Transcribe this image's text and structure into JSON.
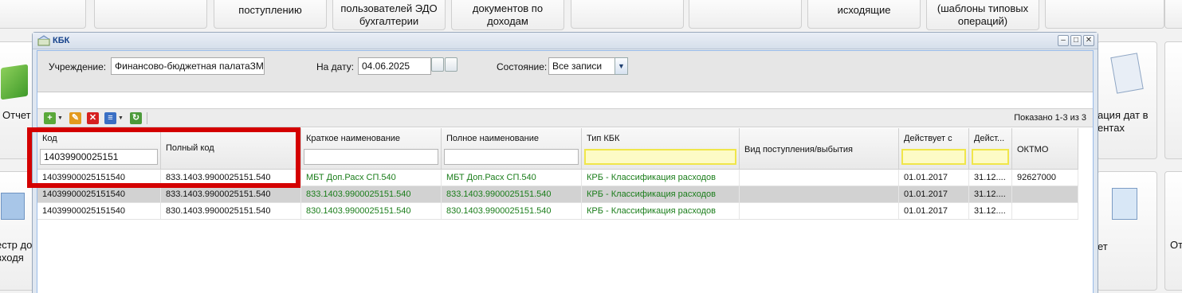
{
  "background_tiles": [
    {
      "id": "tile-1",
      "label": ""
    },
    {
      "id": "tile-2",
      "label": "поступлению"
    },
    {
      "id": "tile-3",
      "label": "пользователей ЭДО бухгалтерии"
    },
    {
      "id": "tile-4",
      "label": "документов по доходам"
    },
    {
      "id": "tile-5",
      "label": ""
    },
    {
      "id": "tile-6",
      "label": ""
    },
    {
      "id": "tile-7",
      "label": "исходящие"
    },
    {
      "id": "tile-8",
      "label": "(шаблоны типовых операций)"
    },
    {
      "id": "tile-left-1",
      "label": "Отчет"
    },
    {
      "id": "tile-left-2",
      "label": "естр до входя"
    },
    {
      "id": "tile-right-1",
      "label": "ация дат в ентах"
    },
    {
      "id": "tile-right-2",
      "label": "ет"
    },
    {
      "id": "tile-right-3",
      "label": "От"
    }
  ],
  "window": {
    "title": "КБК",
    "buttons": {
      "minimize": "–",
      "maximize": "□",
      "close": "✕"
    }
  },
  "filters": {
    "institution_label": "Учреждение:",
    "institution_value": "Финансово-бюджетная палатаЗМ",
    "date_label": "На дату:",
    "date_value": "04.06.2025",
    "state_label": "Состояние:",
    "state_value": "Все записи"
  },
  "toolbar": {
    "add_icon": "+",
    "edit_icon": "✎",
    "delete_icon": "✕",
    "list_icon": "≡",
    "refresh_icon": "↻",
    "shown_text": "Показано 1-3 из 3"
  },
  "grid": {
    "columns": [
      {
        "key": "code",
        "label": "Код",
        "filter": "14039900025151"
      },
      {
        "key": "full_code",
        "label": "Полный код",
        "filter": ""
      },
      {
        "key": "short_name",
        "label": "Краткое наименование",
        "filter": ""
      },
      {
        "key": "full_name",
        "label": "Полное наименование",
        "filter": ""
      },
      {
        "key": "kbk_type",
        "label": "Тип КБК",
        "filter": ""
      },
      {
        "key": "income_type",
        "label": "Вид поступления/выбытия",
        "filter": ""
      },
      {
        "key": "valid_from",
        "label": "Действует с",
        "filter": ""
      },
      {
        "key": "valid_to",
        "label": "Дейст...",
        "filter": ""
      },
      {
        "key": "oktmo",
        "label": "ОКТМО",
        "filter": ""
      }
    ],
    "rows": [
      {
        "code": "14039900025151540",
        "full_code": "833.1403.9900025151.540",
        "short_name": "МБТ Доп.Расх СП.540",
        "full_name": "МБТ Доп.Расх СП.540",
        "kbk_type": "КРБ - Классификация расходов",
        "income_type": "",
        "valid_from": "01.01.2017",
        "valid_to": "31.12....",
        "oktmo": "92627000"
      },
      {
        "code": "14039900025151540",
        "full_code": "833.1403.9900025151.540",
        "short_name": "833.1403.9900025151.540",
        "full_name": "833.1403.9900025151.540",
        "kbk_type": "КРБ - Классификация расходов",
        "income_type": "",
        "valid_from": "01.01.2017",
        "valid_to": "31.12....",
        "oktmo": ""
      },
      {
        "code": "14039900025151540",
        "full_code": "830.1403.9900025151.540",
        "short_name": "830.1403.9900025151.540",
        "full_name": "830.1403.9900025151.540",
        "kbk_type": "КРБ - Классификация расходов",
        "income_type": "",
        "valid_from": "01.01.2017",
        "valid_to": "31.12....",
        "oktmo": ""
      }
    ]
  },
  "colors": {
    "highlight": "#d40000",
    "green_text": "#1a7d1a",
    "selected_row": "#d2d2d2"
  }
}
